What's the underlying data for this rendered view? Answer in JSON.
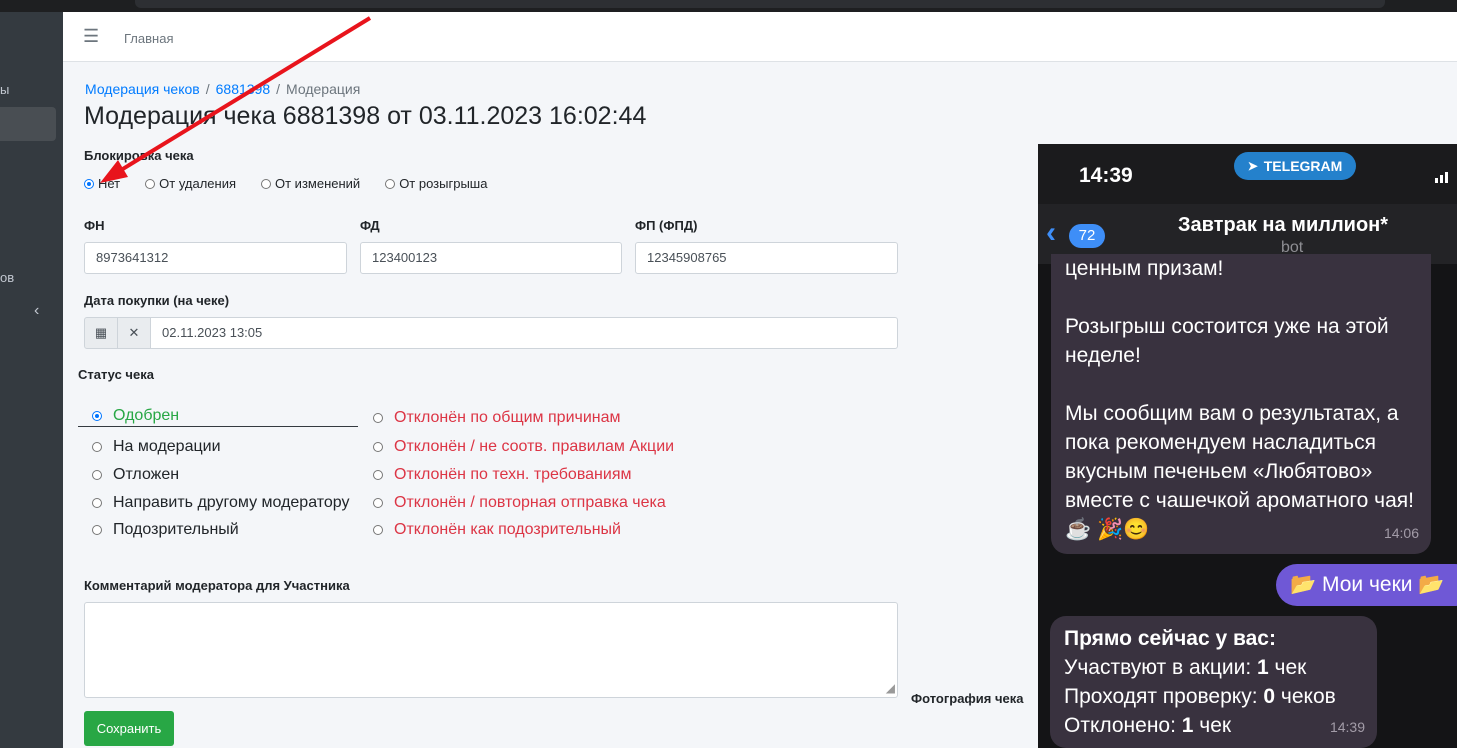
{
  "navbar": {
    "home": "Главная"
  },
  "sidebar": {
    "text1": "ы",
    "text2": "ов"
  },
  "breadcrumb": {
    "item1": "Модерация чеков",
    "item2": "6881398",
    "current": "Модерация"
  },
  "page_title": "Модерация чека 6881398 от 03.11.2023 16:02:44",
  "block": {
    "label": "Блокировка чека",
    "options": [
      "Нет",
      "От удаления",
      "От изменений",
      "От розыгрыша"
    ],
    "selected": "Нет"
  },
  "fields": {
    "fn_label": "ФН",
    "fn_value": "8973641312",
    "fd_label": "ФД",
    "fd_value": "123400123",
    "fp_label": "ФП (ФПД)",
    "fp_value": "12345908765",
    "date_label": "Дата покупки (на чеке)",
    "date_value": "02.11.2023 13:05"
  },
  "status": {
    "label": "Статус чека",
    "left": [
      "Одобрен",
      "На модерации",
      "Отложен",
      "Направить другому модератору",
      "Подозрительный"
    ],
    "right": [
      "Отклонён по общим причинам",
      "Отклонён / не соотв. правилам Акции",
      "Отклонён по техн. требованиям",
      "Отклонён / повторная отправка чека",
      "Отклонён как подозрительный"
    ],
    "selected": "Одобрен",
    "colors": {
      "approved": "#28a745",
      "rejected": "#dc3545"
    }
  },
  "comment": {
    "label": "Комментарий модератора для Участника",
    "value": ""
  },
  "save_label": "Сохранить",
  "photo_label": "Фотография чека",
  "phone": {
    "time": "14:39",
    "app_label": "TELEGRAM",
    "unread": "72",
    "chat_name": "Завтрак на миллион*",
    "chat_sub": "bot",
    "msg1_lines": [
      "ценным призам!",
      "",
      "Розыгрыш состоится уже на этой неделе!",
      "",
      "Мы сообщим вам о результатах, а пока рекомендуем насладиться вкусным печеньем «Любятово» вместе с чашечкой ароматного чая! ☕ 🎉😊"
    ],
    "msg1_time": "14:06",
    "button_text": "📂 Мои чеки 📂",
    "msg2_title": "Прямо сейчас у вас:",
    "msg2_line1_a": "Участвуют в акции: ",
    "msg2_line1_b": "1",
    "msg2_line1_c": " чек",
    "msg2_line2_a": "Проходят проверку: ",
    "msg2_line2_b": "0",
    "msg2_line2_c": " чеков",
    "msg2_line3_a": "Отклонено: ",
    "msg2_line3_b": "1",
    "msg2_line3_c": " чек",
    "msg2_time": "14:39"
  },
  "annotation_color": "#e8141c"
}
